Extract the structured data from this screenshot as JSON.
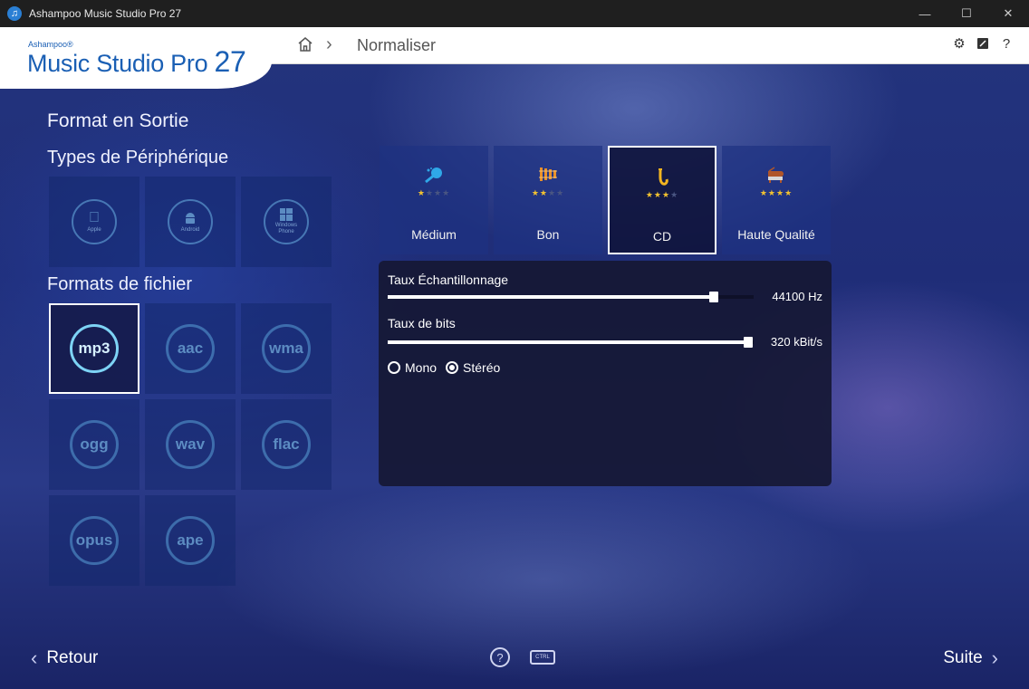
{
  "window": {
    "title": "Ashampoo Music Studio Pro 27"
  },
  "logo": {
    "brand": "Ashampoo®",
    "name": "Music Studio Pro",
    "version": "27"
  },
  "breadcrumb": {
    "current": "Normaliser"
  },
  "headings": {
    "output_format": "Format en Sortie",
    "device_types": "Types de Périphérique",
    "file_formats": "Formats de fichier"
  },
  "devices": [
    {
      "label": "Apple",
      "icon": "apple-icon"
    },
    {
      "label": "Android",
      "icon": "android-icon"
    },
    {
      "label": "Windows Phone",
      "icon": "windows-icon"
    }
  ],
  "formats": [
    "mp3",
    "aac",
    "wma",
    "ogg",
    "wav",
    "flac",
    "opus",
    "ape"
  ],
  "selected_format": "mp3",
  "quality": [
    {
      "label": "Médium",
      "stars": 1,
      "icon": "flute-icon"
    },
    {
      "label": "Bon",
      "stars": 2,
      "icon": "xylophone-icon"
    },
    {
      "label": "CD",
      "stars": 3,
      "icon": "saxophone-icon",
      "selected": true
    },
    {
      "label": "Haute Qualité",
      "stars": 4,
      "icon": "piano-icon"
    }
  ],
  "settings": {
    "sample_rate_label": "Taux Échantillonnage",
    "sample_rate_value": "44100 Hz",
    "sample_rate_level": 0.89,
    "bitrate_label": "Taux de bits",
    "bitrate_value": "320 kBit/s",
    "bitrate_level": 0.985,
    "mono_label": "Mono",
    "stereo_label": "Stéréo",
    "channel": "stereo"
  },
  "footer": {
    "back": "Retour",
    "next": "Suite",
    "ctrl": "CTRL"
  },
  "colors": {
    "accent": "#1a5fb4",
    "star": "#f2c230",
    "selected_ring": "#7dd3f5"
  }
}
